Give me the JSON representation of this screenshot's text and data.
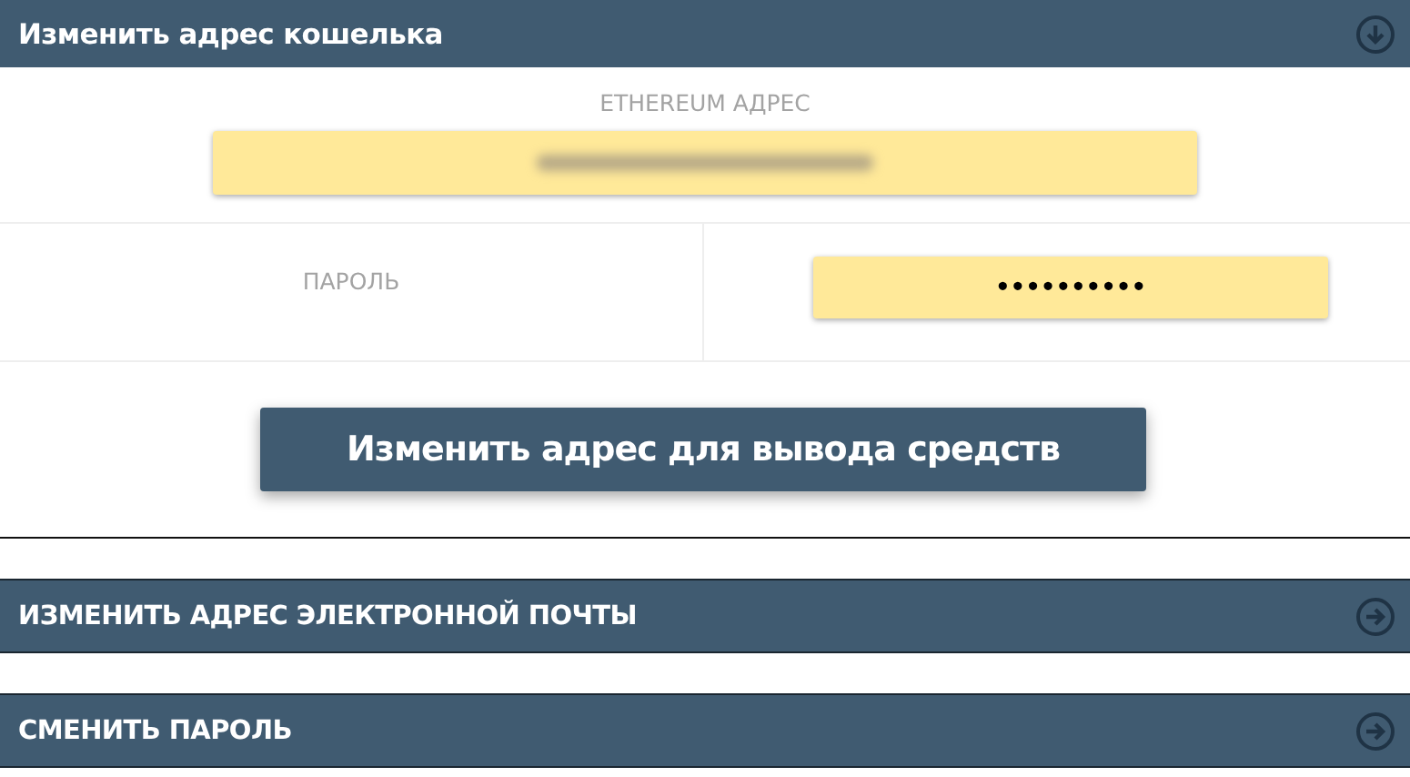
{
  "sections": [
    {
      "title": "Изменить адрес кошелька",
      "expanded": true,
      "address_label": "ETHEREUM АДРЕС",
      "address_redacted": true,
      "password_label": "ПАРОЛЬ",
      "password_value": "••••••••••",
      "button": "Изменить адрес для вывода средств"
    },
    {
      "title": "ИЗМЕНИТЬ АДРЕС ЭЛЕКТРОННОЙ ПОЧТЫ",
      "expanded": false
    },
    {
      "title": "СМЕНИТЬ ПАРОЛЬ",
      "expanded": false
    }
  ]
}
